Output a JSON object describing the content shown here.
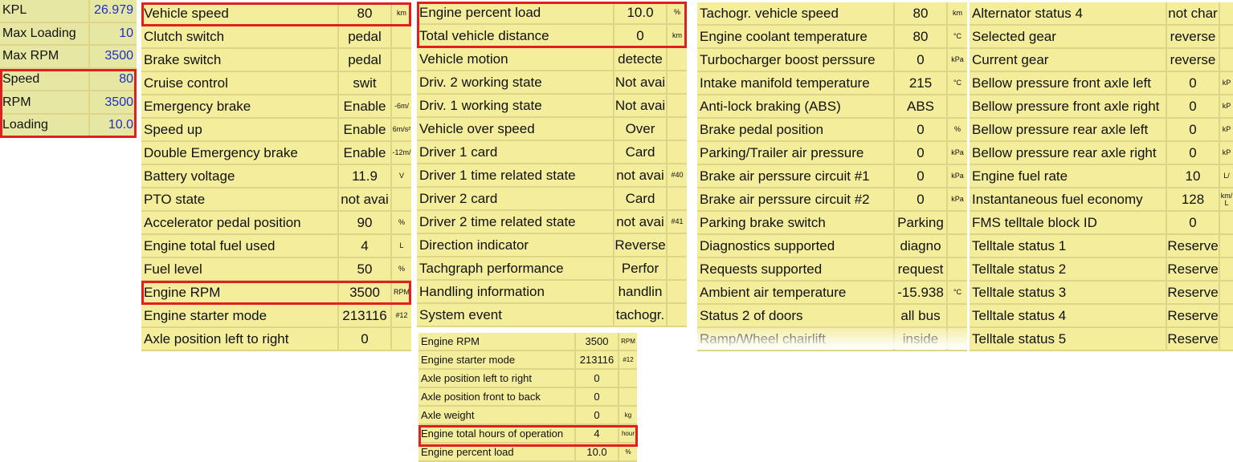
{
  "kpl_panel": [
    {
      "label": "KPL",
      "value": "26.979"
    },
    {
      "label": "Max Loading",
      "value": "10"
    },
    {
      "label": "Max RPM",
      "value": "3500"
    },
    {
      "label": "Speed",
      "value": "80"
    },
    {
      "label": "RPM",
      "value": "3500"
    },
    {
      "label": "Loading",
      "value": "10.0"
    }
  ],
  "panel_a": [
    {
      "label": "Vehicle speed",
      "value": "80",
      "unit": "km"
    },
    {
      "label": "Clutch switch",
      "value": "pedal",
      "unit": ""
    },
    {
      "label": "Brake switch",
      "value": "pedal",
      "unit": ""
    },
    {
      "label": "Cruise control",
      "value": "swit",
      "unit": ""
    },
    {
      "label": "Emergency brake",
      "value": "Enable",
      "unit": "-6m/"
    },
    {
      "label": "Speed up",
      "value": "Enable",
      "unit": "6m/s²"
    },
    {
      "label": "Double Emergency brake",
      "value": "Enable",
      "unit": "-12m/"
    },
    {
      "label": "Battery voltage",
      "value": "11.9",
      "unit": "V"
    },
    {
      "label": "PTO state",
      "value": "not avai",
      "unit": ""
    },
    {
      "label": "Accelerator pedal position",
      "value": "90",
      "unit": "%"
    },
    {
      "label": "Engine total fuel used",
      "value": "4",
      "unit": "L"
    },
    {
      "label": "Fuel level",
      "value": "50",
      "unit": "%"
    },
    {
      "label": "Engine RPM",
      "value": "3500",
      "unit": "RPM"
    },
    {
      "label": "Engine starter mode",
      "value": "213116",
      "unit": "#12"
    },
    {
      "label": "Axle position left to right",
      "value": "0",
      "unit": ""
    }
  ],
  "panel_b": [
    {
      "label": "Engine percent load",
      "value": "10.0",
      "unit": "%"
    },
    {
      "label": "Total vehicle distance",
      "value": "0",
      "unit": "km"
    },
    {
      "label": "Vehicle motion",
      "value": "detecte",
      "unit": ""
    },
    {
      "label": "Driv. 2 working state",
      "value": "Not avai",
      "unit": ""
    },
    {
      "label": "Driv. 1 working state",
      "value": "Not avai",
      "unit": ""
    },
    {
      "label": "Vehicle over speed",
      "value": "Over",
      "unit": ""
    },
    {
      "label": "Driver 1 card",
      "value": "Card",
      "unit": ""
    },
    {
      "label": "Driver 1 time related state",
      "value": "not avai",
      "unit": "#40"
    },
    {
      "label": "Driver 2 card",
      "value": "Card",
      "unit": ""
    },
    {
      "label": "Driver 2 time related state",
      "value": "not avai",
      "unit": "#41"
    },
    {
      "label": "Direction indicator",
      "value": "Reverse",
      "unit": ""
    },
    {
      "label": "Tachgraph performance",
      "value": "Perfor",
      "unit": ""
    },
    {
      "label": "Handling information",
      "value": "handlin",
      "unit": ""
    },
    {
      "label": "System event",
      "value": "tachogr.",
      "unit": ""
    }
  ],
  "panel_c": [
    {
      "label": "Engine RPM",
      "value": "3500",
      "unit": "RPM"
    },
    {
      "label": "Engine starter mode",
      "value": "213116",
      "unit": "#12"
    },
    {
      "label": "Axle position left to right",
      "value": "0",
      "unit": ""
    },
    {
      "label": "Axle position front to back",
      "value": "0",
      "unit": ""
    },
    {
      "label": "Axle weight",
      "value": "0",
      "unit": "kg"
    },
    {
      "label": "Engine total hours of operation",
      "value": "4",
      "unit": "hour"
    },
    {
      "label": "Engine percent load",
      "value": "10.0",
      "unit": "%"
    }
  ],
  "panel_d": [
    {
      "label": "Tachogr. vehicle speed",
      "value": "80",
      "unit": "km"
    },
    {
      "label": "Engine coolant temperature",
      "value": "80",
      "unit": "°C"
    },
    {
      "label": "Turbocharger boost perssure",
      "value": "0",
      "unit": "kPa"
    },
    {
      "label": "Intake manifold temperature",
      "value": "215",
      "unit": "°C"
    },
    {
      "label": "Anti-lock braking (ABS)",
      "value": "ABS",
      "unit": ""
    },
    {
      "label": "Brake pedal position",
      "value": "0",
      "unit": "%"
    },
    {
      "label": "Parking/Trailer air pressure",
      "value": "0",
      "unit": "kPa"
    },
    {
      "label": "Brake air perssure circuit #1",
      "value": "0",
      "unit": "kPa"
    },
    {
      "label": "Brake air perssure circuit #2",
      "value": "0",
      "unit": "kPa"
    },
    {
      "label": "Parking brake switch",
      "value": "Parking",
      "unit": ""
    },
    {
      "label": "Diagnostics supported",
      "value": "diagno",
      "unit": ""
    },
    {
      "label": "Requests supported",
      "value": "request",
      "unit": ""
    },
    {
      "label": "Ambient air temperature",
      "value": "-15.938",
      "unit": "°C"
    },
    {
      "label": "Status 2 of doors",
      "value": "all bus",
      "unit": ""
    },
    {
      "label": "Ramp/Wheel chairlift",
      "value": "inside",
      "unit": ""
    }
  ],
  "panel_e": [
    {
      "label": "Alternator status 4",
      "value": "not char",
      "unit": ""
    },
    {
      "label": "Selected gear",
      "value": "reverse",
      "unit": ""
    },
    {
      "label": "Current gear",
      "value": "reverse",
      "unit": ""
    },
    {
      "label": "Bellow pressure front axle left",
      "value": "0",
      "unit": "kP"
    },
    {
      "label": "Bellow pressure front axle right",
      "value": "0",
      "unit": "kP"
    },
    {
      "label": "Bellow pressure rear axle left",
      "value": "0",
      "unit": "kP"
    },
    {
      "label": "Bellow pressure rear axle right",
      "value": "0",
      "unit": "kP"
    },
    {
      "label": "Engine fuel rate",
      "value": "10",
      "unit": "L/"
    },
    {
      "label": "Instantaneous fuel economy",
      "value": "128",
      "unit": "km/L"
    },
    {
      "label": "FMS telltale block ID",
      "value": "0",
      "unit": ""
    },
    {
      "label": "Telltale status 1",
      "value": "Reserve",
      "unit": ""
    },
    {
      "label": "Telltale status 2",
      "value": "Reserve",
      "unit": ""
    },
    {
      "label": "Telltale status 3",
      "value": "Reserve",
      "unit": ""
    },
    {
      "label": "Telltale status 4",
      "value": "Reserve",
      "unit": ""
    },
    {
      "label": "Telltale status 5",
      "value": "Reserve",
      "unit": ""
    }
  ]
}
